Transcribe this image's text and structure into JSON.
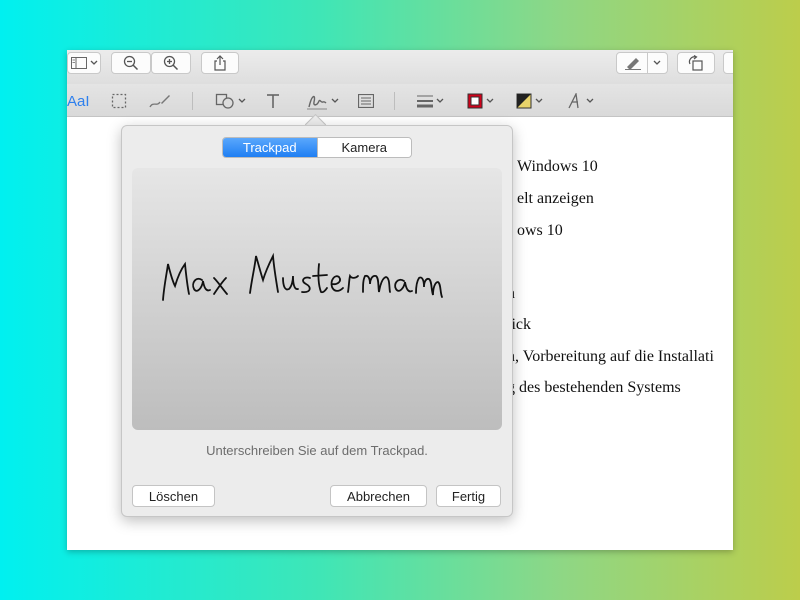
{
  "toolbar": {
    "text_style_label": "AaI"
  },
  "document": {
    "lines": [
      "Windows 10",
      "elt anzeigen",
      "ows 10",
      "n",
      "lick",
      "n, Vorbereitung auf die Installati",
      "g des bestehenden Systems"
    ]
  },
  "signature_popover": {
    "tabs": [
      "Trackpad",
      "Kamera"
    ],
    "active_tab": "Trackpad",
    "signature_text": "Max Mustermann",
    "hint": "Unterschreiben Sie auf dem Trackpad.",
    "buttons": {
      "clear": "Löschen",
      "cancel": "Abbrechen",
      "done": "Fertig"
    }
  },
  "colors": {
    "accent": "#1f7ff3",
    "border_color_swatch": "#d0021b",
    "fill_color_swatch": "#e8d36a"
  }
}
